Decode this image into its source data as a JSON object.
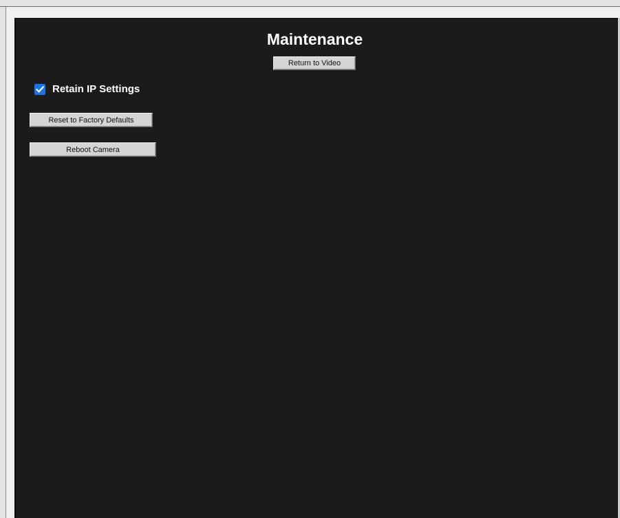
{
  "page": {
    "title": "Maintenance"
  },
  "buttons": {
    "return_to_video": "Return to Video",
    "reset_to_factory_defaults": "Reset to Factory Defaults",
    "reboot_camera": "Reboot Camera"
  },
  "retain_ip": {
    "label": "Retain IP Settings",
    "checked": true,
    "icon": "checkmark-icon"
  },
  "colors": {
    "panel_background": "#1b1b1b",
    "checkbox_accent": "#1a73e8",
    "button_background": "#d4d4d4",
    "text_light": "#ffffff"
  }
}
